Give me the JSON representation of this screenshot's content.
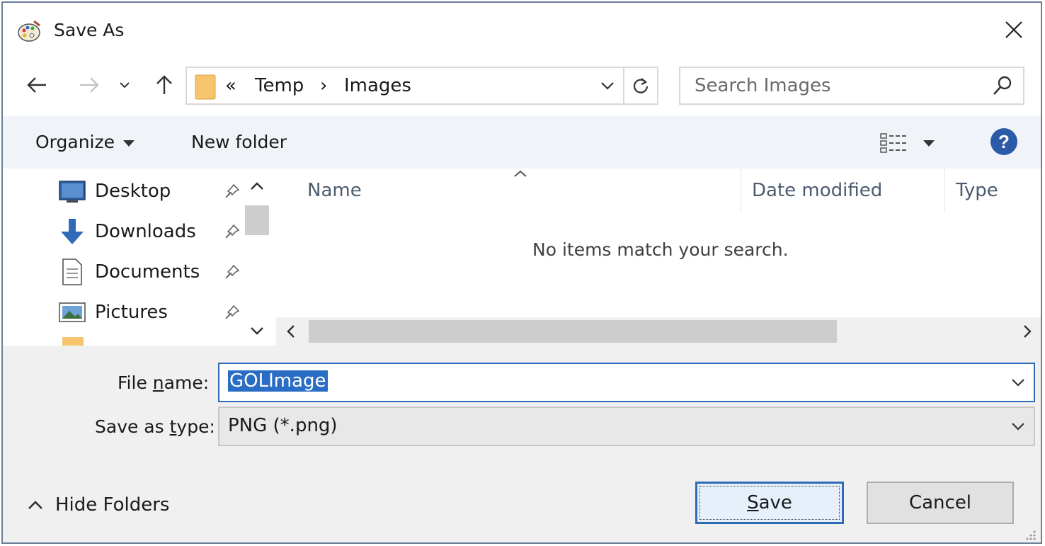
{
  "window": {
    "title": "Save As"
  },
  "nav": {
    "breadcrumb": [
      "«",
      "Temp",
      "›",
      "Images"
    ],
    "search_placeholder": "Search Images"
  },
  "toolbar": {
    "organize_label": "Organize",
    "new_folder_label": "New folder"
  },
  "sidebar": {
    "items": [
      {
        "label": "Desktop",
        "icon": "desktop-icon"
      },
      {
        "label": "Downloads",
        "icon": "download-arrow-icon"
      },
      {
        "label": "Documents",
        "icon": "document-icon"
      },
      {
        "label": "Pictures",
        "icon": "picture-icon"
      }
    ]
  },
  "filelist": {
    "columns": [
      "Name",
      "Date modified",
      "Type"
    ],
    "empty_message": "No items match your search."
  },
  "form": {
    "file_name_label_pre": "File ",
    "file_name_label_u": "n",
    "file_name_label_post": "ame:",
    "file_name_value": "GOLImage",
    "save_type_label_pre": "Save as ",
    "save_type_label_u": "t",
    "save_type_label_post": "ype:",
    "save_type_value": "PNG (*.png)"
  },
  "footer": {
    "hide_folders_label": "Hide Folders",
    "save_label_u": "S",
    "save_label_rest": "ave",
    "cancel_label": "Cancel"
  },
  "colors": {
    "accent": "#2f6bb8",
    "selection": "#2a6dc4",
    "toolbar_bg": "#f0f4f9",
    "footer_bg": "#f0f0f0"
  }
}
